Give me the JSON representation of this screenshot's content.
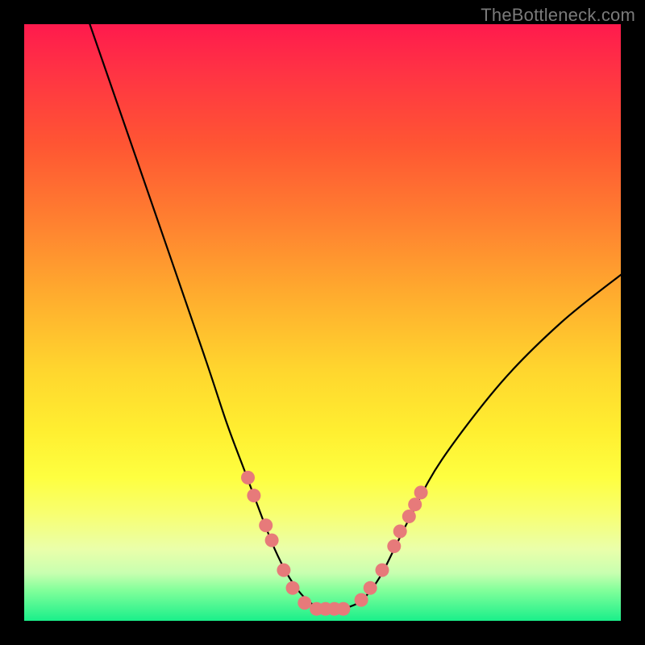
{
  "watermark": "TheBottleneck.com",
  "chart_data": {
    "type": "line",
    "title": "",
    "xlabel": "",
    "ylabel": "",
    "xlim": [
      0,
      100
    ],
    "ylim": [
      0,
      100
    ],
    "series": [
      {
        "name": "bottleneck-curve",
        "x": [
          11,
          20,
          30,
          34,
          37,
          40,
          42,
          44,
          46,
          48,
          50,
          53,
          56,
          58,
          60,
          62,
          65,
          70,
          80,
          90,
          100
        ],
        "y": [
          100,
          74,
          45,
          33,
          25,
          17,
          12,
          8,
          5,
          3,
          2,
          2,
          3,
          5,
          8,
          12,
          18,
          27,
          40,
          50,
          58
        ]
      }
    ],
    "markers": {
      "name": "highlight-dots",
      "color": "#e77a7a",
      "points": [
        {
          "x": 37.5,
          "y": 24
        },
        {
          "x": 38.5,
          "y": 21
        },
        {
          "x": 40.5,
          "y": 16
        },
        {
          "x": 41.5,
          "y": 13.5
        },
        {
          "x": 43.5,
          "y": 8.5
        },
        {
          "x": 45.0,
          "y": 5.5
        },
        {
          "x": 47.0,
          "y": 3.0
        },
        {
          "x": 49.0,
          "y": 2.0
        },
        {
          "x": 50.5,
          "y": 2.0
        },
        {
          "x": 52.0,
          "y": 2.0
        },
        {
          "x": 53.5,
          "y": 2.0
        },
        {
          "x": 56.5,
          "y": 3.5
        },
        {
          "x": 58.0,
          "y": 5.5
        },
        {
          "x": 60.0,
          "y": 8.5
        },
        {
          "x": 62.0,
          "y": 12.5
        },
        {
          "x": 63.0,
          "y": 15.0
        },
        {
          "x": 64.5,
          "y": 17.5
        },
        {
          "x": 65.5,
          "y": 19.5
        },
        {
          "x": 66.5,
          "y": 21.5
        }
      ]
    }
  }
}
